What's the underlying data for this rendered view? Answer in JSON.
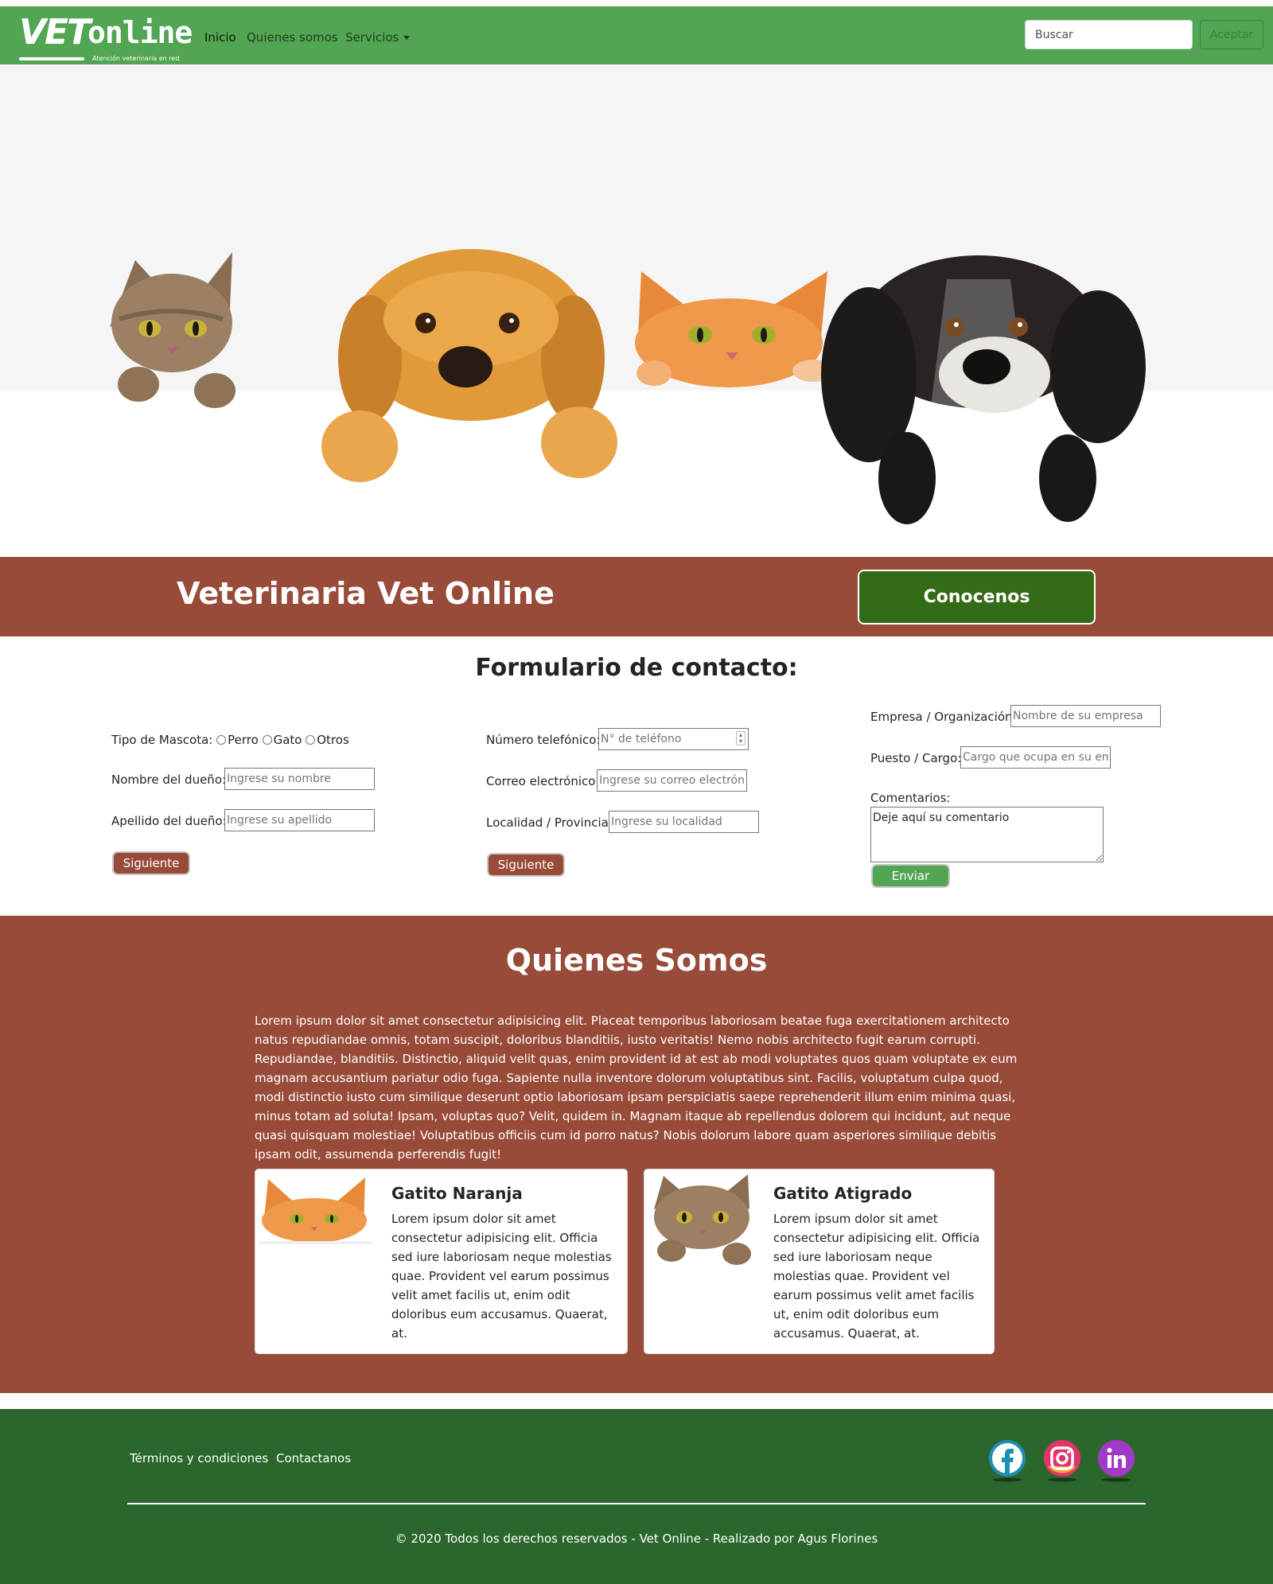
{
  "nav": {
    "logo_main": "VET",
    "logo_sub": "online",
    "logo_tagline": "Atención veterinaria en red",
    "links": [
      "Inicio",
      "Quienes somos",
      "Servicios"
    ],
    "search_placeholder": "Buscar",
    "search_button": "Aceptar"
  },
  "banner": {
    "title": "Veterinaria Vet Online",
    "button": "Conocenos"
  },
  "form": {
    "title": "Formulario de contacto:",
    "pet_type_label": "Tipo de Mascota:",
    "pet_options": [
      "Perro",
      "Gato",
      "Otros"
    ],
    "owner_name_label": "Nombre del dueño:",
    "owner_name_placeholder": "Ingrese su nombre",
    "owner_surname_label": "Apellido del dueño:",
    "owner_surname_placeholder": "Ingrese su apellido",
    "next_button": "Siguiente",
    "phone_label": "Número telefónico:",
    "phone_placeholder": "N° de teléfono",
    "email_label": "Correo electrónico:",
    "email_placeholder": "Ingrese su correo electrónico",
    "location_label": "Localidad / Provincia:",
    "location_placeholder": "Ingrese su localidad",
    "company_label": "Empresa / Organización:",
    "company_placeholder": "Nombre de su empresa",
    "position_label": "Puesto / Cargo:",
    "position_placeholder": "Cargo que ocupa en su empresa",
    "comments_label": "Comentarios:",
    "comments_value": "Deje aquí su comentario",
    "send_button": "Enviar"
  },
  "about": {
    "title": "Quienes Somos",
    "text": "Lorem ipsum dolor sit amet consectetur adipisicing elit. Placeat temporibus laboriosam beatae fuga exercitationem architecto natus repudiandae omnis, totam suscipit, doloribus blanditiis, iusto veritatis! Nemo nobis architecto fugit earum corrupti. Repudiandae, blanditiis. Distinctio, aliquid velit quas, enim provident id at est ab modi voluptates quos quam voluptate ex eum magnam accusantium pariatur odio fuga. Sapiente nulla inventore dolorum voluptatibus sint. Facilis, voluptatum culpa quod, modi distinctio iusto cum similique deserunt optio laboriosam ipsam perspiciatis saepe reprehenderit illum enim minima quasi, minus totam ad soluta! Ipsam, voluptas quo? Velit, quidem in. Magnam itaque ab repellendus dolorem qui incidunt, aut neque quasi quisquam molestiae! Voluptatibus officiis cum id porro natus? Nobis dolorum labore quam asperiores similique debitis ipsam odit, assumenda perferendis fugit!",
    "cards": [
      {
        "title": "Gatito Naranja",
        "text": "Lorem ipsum dolor sit amet consectetur adipisicing elit. Officia sed iure laboriosam neque molestias quae. Provident vel earum possimus velit amet facilis ut, enim odit doloribus eum accusamus. Quaerat, at."
      },
      {
        "title": "Gatito Atigrado",
        "text": "Lorem ipsum dolor sit amet consectetur adipisicing elit. Officia sed iure laboriosam neque molestias quae. Provident vel earum possimus velit amet facilis ut, enim odit doloribus eum accusamus. Quaerat, at."
      }
    ]
  },
  "footer": {
    "links": [
      "Términos y condiciones",
      "Contactanos"
    ],
    "social": [
      "facebook-icon",
      "instagram-icon",
      "linkedin-icon"
    ],
    "copyright": "© 2020 Todos los derechos reservados - Vet Online - Realizado por Agus Florines"
  },
  "colors": {
    "nav_green": "#52a552",
    "brown": "#984b39",
    "dark_green_button": "#336b17",
    "footer_green": "#2b672d"
  }
}
